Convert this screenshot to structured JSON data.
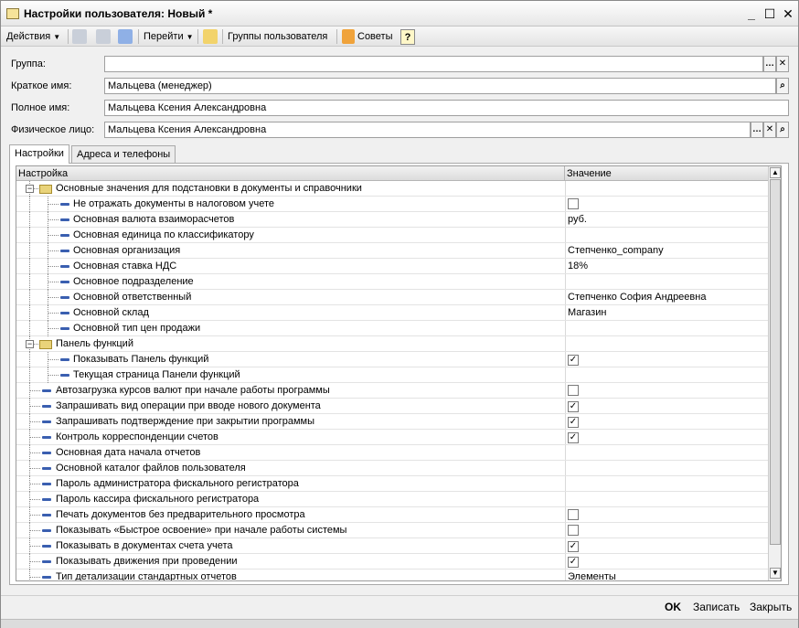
{
  "window": {
    "title": "Настройки пользователя: Новый *"
  },
  "toolbar": {
    "actions_label": "Действия",
    "goto_label": "Перейти",
    "groups_label": "Группы пользователя",
    "tips_label": "Советы",
    "help_glyph": "?"
  },
  "form": {
    "group": {
      "label": "Группа:",
      "value": ""
    },
    "short_name": {
      "label": "Краткое имя:",
      "value": "Мальцева (менеджер)"
    },
    "full_name": {
      "label": "Полное имя:",
      "value": "Мальцева Ксения Александровна"
    },
    "person": {
      "label": "Физическое лицо:",
      "value": "Мальцева Ксения Александровна"
    }
  },
  "tabs": [
    {
      "label": "Настройки",
      "active": true
    },
    {
      "label": "Адреса и телефоны",
      "active": false
    }
  ],
  "grid": {
    "columns": [
      "Настройка",
      "Значение"
    ],
    "rows": [
      {
        "level": 0,
        "type": "folder",
        "name": "Основные значения для подстановки в документы и справочники",
        "value": ""
      },
      {
        "level": 1,
        "type": "item",
        "name": "Не отражать документы в налоговом учете",
        "value": "",
        "check": "unchecked"
      },
      {
        "level": 1,
        "type": "item",
        "name": "Основная валюта взаиморасчетов",
        "value": "руб."
      },
      {
        "level": 1,
        "type": "item",
        "name": "Основная единица по классификатору",
        "value": ""
      },
      {
        "level": 1,
        "type": "item",
        "name": "Основная организация",
        "value": "Степченко_company"
      },
      {
        "level": 1,
        "type": "item",
        "name": "Основная ставка НДС",
        "value": "18%"
      },
      {
        "level": 1,
        "type": "item",
        "name": "Основное подразделение",
        "value": ""
      },
      {
        "level": 1,
        "type": "item",
        "name": "Основной ответственный",
        "value": "Степченко София Андреевна"
      },
      {
        "level": 1,
        "type": "item",
        "name": "Основной склад",
        "value": "Магазин"
      },
      {
        "level": 1,
        "type": "item",
        "name": "Основной тип цен продажи",
        "value": ""
      },
      {
        "level": 0,
        "type": "folder",
        "name": "Панель функций",
        "value": ""
      },
      {
        "level": 1,
        "type": "item",
        "name": "Показывать Панель функций",
        "value": "",
        "check": "checked"
      },
      {
        "level": 1,
        "type": "item",
        "name": "Текущая страница Панели функций",
        "value": ""
      },
      {
        "level": 0,
        "type": "item",
        "name": "Автозагрузка курсов валют при начале работы программы",
        "value": "",
        "check": "unchecked"
      },
      {
        "level": 0,
        "type": "item",
        "name": "Запрашивать вид операции при вводе нового документа",
        "value": "",
        "check": "checked"
      },
      {
        "level": 0,
        "type": "item",
        "name": "Запрашивать подтверждение при закрытии программы",
        "value": "",
        "check": "checked"
      },
      {
        "level": 0,
        "type": "item",
        "name": "Контроль корреспонденции счетов",
        "value": "",
        "check": "checked"
      },
      {
        "level": 0,
        "type": "item",
        "name": "Основная дата начала отчетов",
        "value": ""
      },
      {
        "level": 0,
        "type": "item",
        "name": "Основной каталог файлов пользователя",
        "value": ""
      },
      {
        "level": 0,
        "type": "item",
        "name": "Пароль администратора фискального регистратора",
        "value": ""
      },
      {
        "level": 0,
        "type": "item",
        "name": "Пароль кассира фискального регистратора",
        "value": ""
      },
      {
        "level": 0,
        "type": "item",
        "name": "Печать документов без предварительного просмотра",
        "value": "",
        "check": "unchecked"
      },
      {
        "level": 0,
        "type": "item",
        "name": "Показывать «Быстрое освоение» при начале работы системы",
        "value": "",
        "check": "unchecked"
      },
      {
        "level": 0,
        "type": "item",
        "name": "Показывать в документах счета учета",
        "value": "",
        "check": "checked"
      },
      {
        "level": 0,
        "type": "item",
        "name": "Показывать движения при проведении",
        "value": "",
        "check": "checked"
      },
      {
        "level": 0,
        "type": "item",
        "name": "Тип детализации стандартных отчетов",
        "value": "Элементы"
      }
    ]
  },
  "buttons": {
    "ok": "OK",
    "save": "Записать",
    "close": "Закрыть"
  },
  "colors": {
    "accent": "#3a5fb0",
    "folder": "#e9d37a"
  }
}
